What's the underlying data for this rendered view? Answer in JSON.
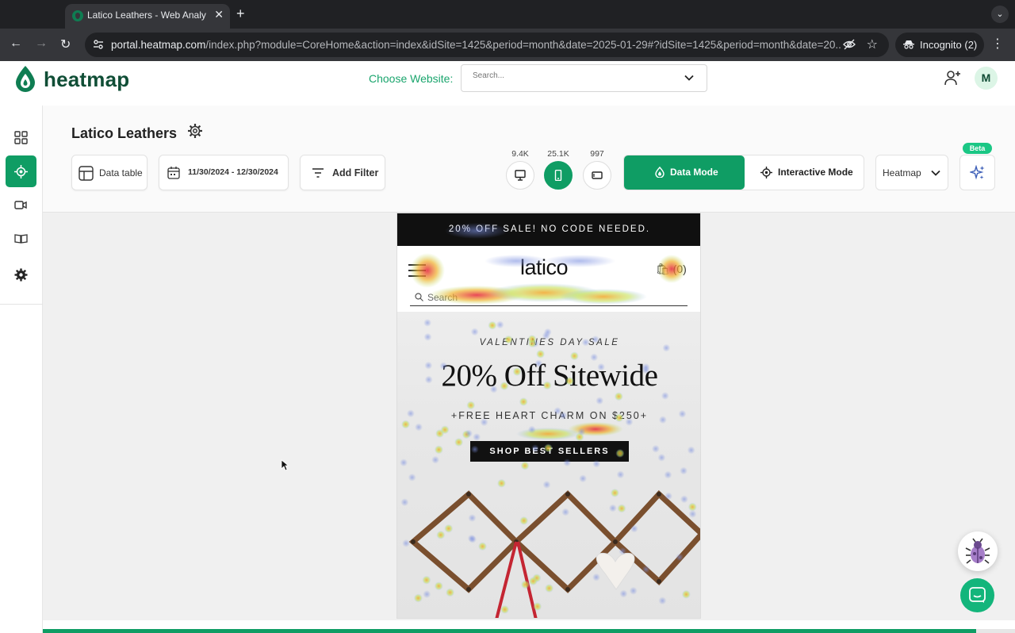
{
  "browser": {
    "tab_title": "Latico Leathers - Web Analytics",
    "url_host": "portal.heatmap.com",
    "url_rest": "/index.php?module=CoreHome&action=index&idSite=1425&period=month&date=2025-01-29#?idSite=1425&period=month&date=20...",
    "incognito_label": "Incognito (2)"
  },
  "app": {
    "logo_text": "heatmap",
    "choose_website_label": "Choose Website:",
    "search_placeholder": "Search...",
    "avatar_initial": "M",
    "brand_color": "#0f9d64"
  },
  "page": {
    "title": "Latico Leathers",
    "data_table_label": "Data table",
    "date_range": "11/30/2024 - 12/30/2024",
    "add_filter_label": "Add Filter",
    "devices": [
      {
        "name": "desktop",
        "count": "9.4K",
        "active": false
      },
      {
        "name": "mobile",
        "count": "25.1K",
        "active": true
      },
      {
        "name": "tablet",
        "count": "997",
        "active": false
      }
    ],
    "data_mode_label": "Data Mode",
    "interactive_mode_label": "Interactive Mode",
    "view_select_label": "Heatmap",
    "beta_badge": "Beta"
  },
  "preview": {
    "promo_text": "20% OFF SALE! NO CODE NEEDED.",
    "brand_logo": "latico",
    "cart_label": "(0)",
    "search_label": "Search",
    "hero_eyebrow": "VALENTINES DAY SALE",
    "hero_title": "20% Off Sitewide",
    "hero_sub": "+FREE HEART CHARM ON $250+",
    "hero_cta": "SHOP BEST SELLERS"
  },
  "loading_progress": 0.96
}
